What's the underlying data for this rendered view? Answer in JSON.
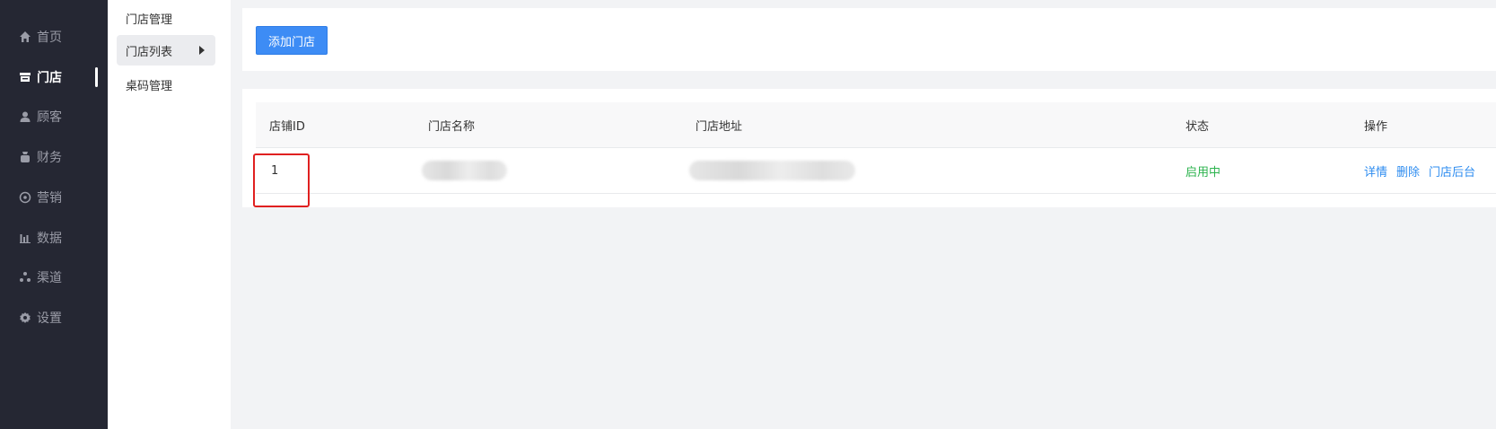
{
  "nav": {
    "items": [
      {
        "label": "首页",
        "icon": "home-icon"
      },
      {
        "label": "门店",
        "icon": "store-icon",
        "active": true
      },
      {
        "label": "顾客",
        "icon": "user-icon"
      },
      {
        "label": "财务",
        "icon": "wallet-icon"
      },
      {
        "label": "营销",
        "icon": "marketing-icon"
      },
      {
        "label": "数据",
        "icon": "chart-icon"
      },
      {
        "label": "渠道",
        "icon": "channel-icon"
      },
      {
        "label": "设置",
        "icon": "gear-icon"
      }
    ]
  },
  "subnav": {
    "title": "门店管理",
    "items": [
      {
        "label": "门店列表",
        "active": true
      },
      {
        "label": "桌码管理"
      }
    ]
  },
  "toolbar": {
    "add_label": "添加门店"
  },
  "table": {
    "columns": [
      "店铺ID",
      "门店名称",
      "门店地址",
      "状态",
      "操作"
    ],
    "rows": [
      {
        "id": "1",
        "name": "",
        "address": "",
        "status": "启用中",
        "actions": [
          "详情",
          "删除",
          "门店后台"
        ]
      }
    ]
  },
  "colors": {
    "nav_bg": "#252733",
    "accent": "#3d8cf5",
    "link": "#2d8cf0",
    "status_on": "#2cb34e",
    "highlight": "#e02020"
  }
}
